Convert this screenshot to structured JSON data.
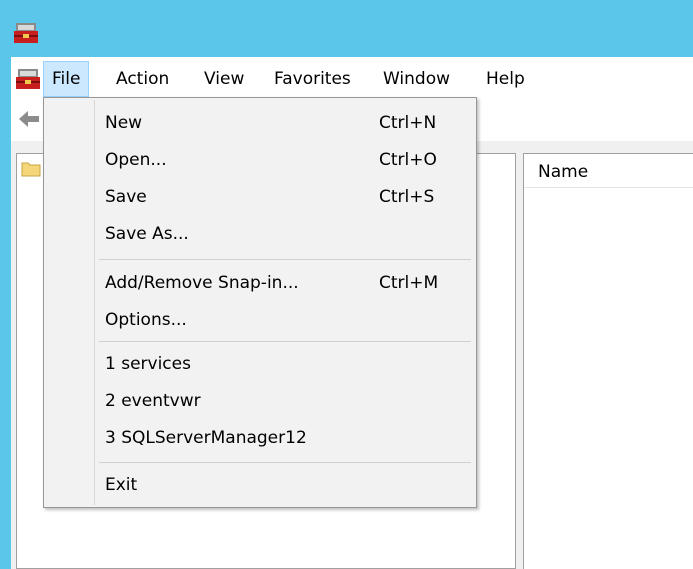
{
  "menu_bar": {
    "items": [
      "File",
      "Action",
      "View",
      "Favorites",
      "Window",
      "Help"
    ],
    "active": "File"
  },
  "list_pane": {
    "columns": [
      "Name"
    ]
  },
  "file_menu": {
    "items": [
      {
        "label": "New",
        "shortcut": "Ctrl+N"
      },
      {
        "label": "Open...",
        "shortcut": "Ctrl+O"
      },
      {
        "label": "Save",
        "shortcut": "Ctrl+S"
      },
      {
        "label": "Save As...",
        "shortcut": ""
      },
      {
        "label": "Add/Remove Snap-in...",
        "shortcut": "Ctrl+M"
      },
      {
        "label": "Options...",
        "shortcut": ""
      },
      {
        "label": "1 services",
        "shortcut": ""
      },
      {
        "label": "2 eventvwr",
        "shortcut": ""
      },
      {
        "label": "3 SQLServerManager12",
        "shortcut": ""
      },
      {
        "label": "Exit",
        "shortcut": ""
      }
    ]
  },
  "icons": {
    "app": "mmc-toolbox-icon",
    "back": "back-arrow-icon",
    "tree_root": "folder-icon"
  },
  "colors": {
    "title_bar": "#5cc5ea",
    "menu_highlight": "#cce8ff",
    "menu_background": "#f2f2f2"
  }
}
